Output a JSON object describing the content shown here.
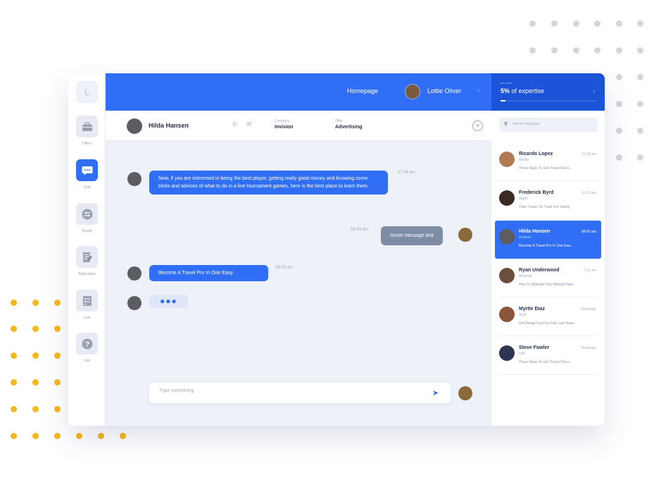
{
  "sidebar": {
    "logo": "L",
    "items": [
      {
        "label": "Offers",
        "icon": "briefcase-icon"
      },
      {
        "label": "Chat",
        "icon": "chat-bubble-icon"
      },
      {
        "label": "Board",
        "icon": "sliders-icon"
      },
      {
        "label": "Application",
        "icon": "document-edit-icon"
      },
      {
        "label": "Lists",
        "icon": "list-icon"
      },
      {
        "label": "Faq",
        "icon": "question-icon"
      }
    ],
    "active_index": 1
  },
  "topbar": {
    "homepage": "Homepage",
    "user_name": "Lottie Oliver"
  },
  "expertise": {
    "caption": "you have",
    "value_bold": "5%",
    "value_rest": " of expertise",
    "progress_fraction": 0.05
  },
  "chat_header": {
    "name": "Hilda Hansen",
    "company_label": "Company",
    "company": "Invision",
    "offer_label": "Offer",
    "offer": "Advertising",
    "close": "×"
  },
  "messages": [
    {
      "side": "left",
      "text": "Now, if you are interested in being the best player, getting really good money and knowing some tricks and advices of what to do in a live tournament games, here is the best place to learn them.",
      "time": "07:44 am"
    },
    {
      "side": "right",
      "text": "Some message text",
      "time": "08:43 am"
    },
    {
      "side": "left",
      "text": "Become A Travel Pro In One Easy",
      "time": "08:43 am"
    },
    {
      "side": "left",
      "text": "●●●",
      "time": ""
    }
  ],
  "composer": {
    "placeholder": "Type something",
    "send": "➤"
  },
  "search": {
    "placeholder": "search messages"
  },
  "contacts": [
    {
      "name": "Ricardo Lopez",
      "company": "Adobe",
      "time": "11:23 am",
      "preview": "Three Ways To Get Travel Disco...",
      "avatar_color": "#b07a55"
    },
    {
      "name": "Frederick Byrd",
      "company": "Apple",
      "time": "10:11 am",
      "preview": "Train Travel On Track For Safety",
      "avatar_color": "#3a2a22"
    },
    {
      "name": "Hilda Hansen",
      "company": "Invision",
      "time": "08:43 am",
      "preview": "Become A Travel Pro In One Eas..",
      "avatar_color": "#5b5d63"
    },
    {
      "name": "Ryan Underwood",
      "company": "Amoeda",
      "time": "7:11 am",
      "preview": "How To Maintain Your Mental Heal..",
      "avatar_color": "#6b4e3d"
    },
    {
      "name": "Myrtle Diaz",
      "company": "Audi",
      "time": "Yesterday",
      "preview": "Get Ready Fast For Fall Leaf Viewi...",
      "avatar_color": "#8a5538"
    },
    {
      "name": "Steve Fowler",
      "company": "Dell",
      "time": "Yesterday",
      "preview": "Three Ways To Get Travel Disco...",
      "avatar_color": "#2e3552"
    }
  ],
  "active_contact_index": 2,
  "colors": {
    "primary": "#2f6ef5",
    "primary_dark": "#1b54d9",
    "background": "#eef1f8",
    "dot_gray": "#d2d6de",
    "dot_yellow": "#f5b81c"
  }
}
